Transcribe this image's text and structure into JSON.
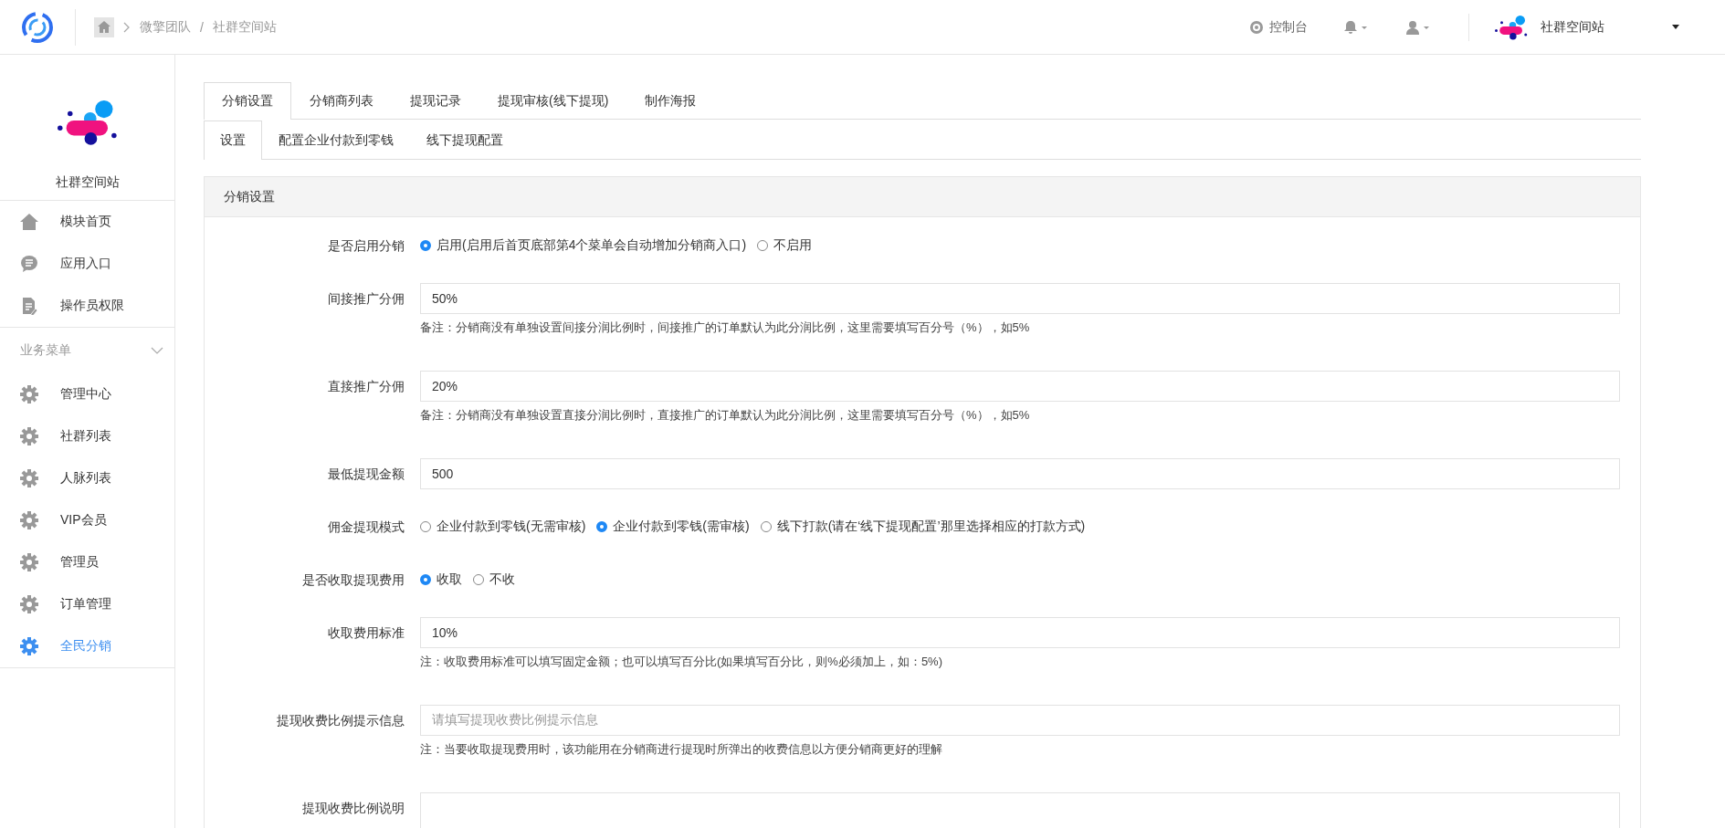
{
  "topbar": {
    "breadcrumb": [
      "微擎团队",
      "社群空间站"
    ],
    "separator": "/",
    "console": "控制台",
    "account": "社群空间站"
  },
  "sidebar": {
    "app_name": "社群空间站",
    "items": [
      {
        "kind": "home",
        "label": "模块首页",
        "selected": false
      },
      {
        "kind": "chat",
        "label": "应用入口",
        "selected": false
      },
      {
        "kind": "document",
        "label": "操作员权限",
        "selected": false
      }
    ],
    "section": {
      "title": "业务菜单",
      "expanded": true,
      "items": [
        {
          "kind": "gear",
          "label": "管理中心",
          "selected": false
        },
        {
          "kind": "gear",
          "label": "社群列表",
          "selected": false
        },
        {
          "kind": "gear",
          "label": "人脉列表",
          "selected": false
        },
        {
          "kind": "gear",
          "label": "VIP会员",
          "selected": false
        },
        {
          "kind": "gear",
          "label": "管理员",
          "selected": false
        },
        {
          "kind": "gear",
          "label": "订单管理",
          "selected": false
        },
        {
          "kind": "gear",
          "label": "全民分销",
          "selected": true
        }
      ]
    }
  },
  "tabs": [
    {
      "label": "分销设置",
      "selected": true
    },
    {
      "label": "分销商列表",
      "selected": false
    },
    {
      "label": "提现记录",
      "selected": false
    },
    {
      "label": "提现审核(线下提现)",
      "selected": false
    },
    {
      "label": "制作海报",
      "selected": false
    }
  ],
  "subtabs": [
    {
      "label": "设置",
      "selected": true
    },
    {
      "label": "配置企业付款到零钱",
      "selected": false
    },
    {
      "label": "线下提现配置",
      "selected": false
    }
  ],
  "panel": {
    "title": "分销设置",
    "fields": [
      {
        "kind": "radio",
        "label": "是否启用分销",
        "options": [
          {
            "label": "启用(启用后首页底部第4个菜单会自动增加分销商入口)",
            "selected": true
          },
          {
            "label": "不启用",
            "selected": false
          }
        ]
      },
      {
        "kind": "input",
        "label": "间接推广分佣",
        "value": "50%",
        "note": "备注：分销商没有单独设置间接分润比例时，间接推广的订单默认为此分润比例，这里需要填写百分号（%），如5%"
      },
      {
        "kind": "input",
        "label": "直接推广分佣",
        "value": "20%",
        "note": "备注：分销商没有单独设置直接分润比例时，直接推广的订单默认为此分润比例，这里需要填写百分号（%），如5%"
      },
      {
        "kind": "input",
        "label": "最低提现金额",
        "value": "500"
      },
      {
        "kind": "radio",
        "label": "佣金提现模式",
        "options": [
          {
            "label": "企业付款到零钱(无需审核)",
            "selected": false
          },
          {
            "label": "企业付款到零钱(需审核)",
            "selected": true
          },
          {
            "label": "线下打款(请在‘线下提现配置’那里选择相应的打款方式)",
            "selected": false
          }
        ]
      },
      {
        "kind": "radio",
        "label": "是否收取提现费用",
        "options": [
          {
            "label": "收取",
            "selected": true
          },
          {
            "label": "不收",
            "selected": false
          }
        ]
      },
      {
        "kind": "input",
        "label": "收取费用标准",
        "value": "10%",
        "note": "注：收取费用标准可以填写固定金额；也可以填写百分比(如果填写百分比，则%必须加上，如：5%)"
      },
      {
        "kind": "input",
        "label": "提现收费比例提示信息",
        "placeholder": "请填写提现收费比例提示信息",
        "note": "注：当要收取提现费用时，该功能用在分销商进行提现时所弹出的收费信息以方便分销商更好的理解"
      },
      {
        "kind": "textarea",
        "label": "提现收费比例说明"
      }
    ]
  }
}
